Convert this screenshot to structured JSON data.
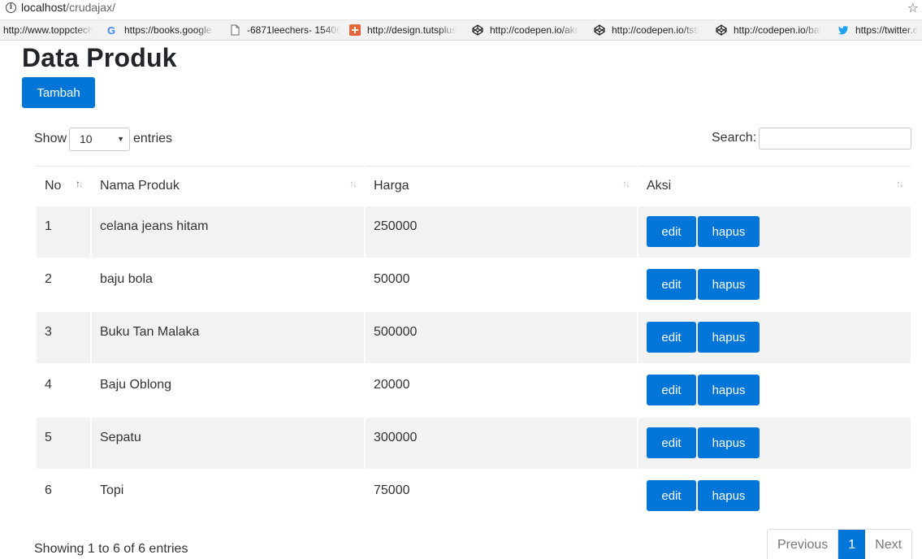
{
  "browser": {
    "url_host": "localhost",
    "url_path": "/crudajax/",
    "bookmarks": [
      {
        "icon": "page-icon",
        "label": "http://www.toppctech"
      },
      {
        "icon": "google-icon",
        "label": "https://books.google."
      },
      {
        "icon": "document-icon",
        "label": "-6871leechers- 15406"
      },
      {
        "icon": "tutsplus-icon",
        "label": "http://design.tutsplus"
      },
      {
        "icon": "codepen-icon",
        "label": "http://codepen.io/akr"
      },
      {
        "icon": "codepen-icon",
        "label": "http://codepen.io/tsti"
      },
      {
        "icon": "codepen-icon",
        "label": "http://codepen.io/bal"
      },
      {
        "icon": "twitter-icon",
        "label": "https://twitter.c"
      }
    ]
  },
  "page": {
    "title": "Data Produk",
    "add_button": "Tambah"
  },
  "table_controls": {
    "show_label": "Show",
    "entries_label": "entries",
    "length_value": "10",
    "search_label": "Search:",
    "search_value": ""
  },
  "table": {
    "columns": [
      "No",
      "Nama Produk",
      "Harga",
      "Aksi"
    ],
    "rows": [
      {
        "no": "1",
        "nama": "celana jeans hitam",
        "harga": "250000"
      },
      {
        "no": "2",
        "nama": "baju bola",
        "harga": "50000"
      },
      {
        "no": "3",
        "nama": "Buku Tan Malaka",
        "harga": "500000"
      },
      {
        "no": "4",
        "nama": "Baju Oblong",
        "harga": "20000"
      },
      {
        "no": "5",
        "nama": "Sepatu",
        "harga": "300000"
      },
      {
        "no": "6",
        "nama": "Topi",
        "harga": "75000"
      }
    ],
    "edit_label": "edit",
    "delete_label": "hapus"
  },
  "footer": {
    "info": "Showing 1 to 6 of 6 entries",
    "previous": "Previous",
    "current_page": "1",
    "next": "Next"
  },
  "colors": {
    "primary": "#0275d8",
    "striped_row": "#f2f2f2"
  }
}
